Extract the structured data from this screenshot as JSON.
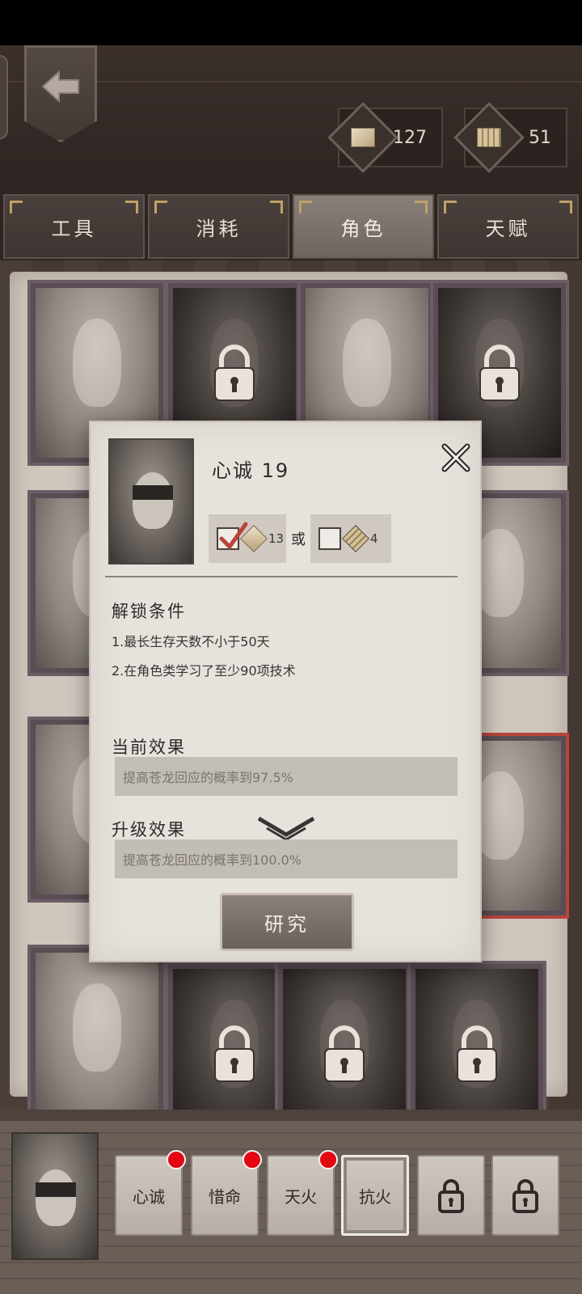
{
  "currencies": [
    {
      "icon": "diamond-currency-icon",
      "value": "127"
    },
    {
      "icon": "book-currency-icon",
      "value": "51"
    }
  ],
  "tabs": [
    {
      "label": "工具",
      "active": false
    },
    {
      "label": "消耗",
      "active": false
    },
    {
      "label": "角色",
      "active": true
    },
    {
      "label": "天赋",
      "active": false
    }
  ],
  "dialog": {
    "title": "心诚 19",
    "cost_option_1": {
      "checked": true,
      "icon": "diamond-currency-icon",
      "amount": "13"
    },
    "or_label": "或",
    "cost_option_2": {
      "checked": false,
      "icon": "book-currency-icon",
      "amount": "4"
    },
    "unlock_title": "解锁条件",
    "conditions": [
      "1.最长生存天数不小于50天",
      "2.在角色类学习了至少90项技术"
    ],
    "current_effect_title": "当前效果",
    "current_effect": "提高苍龙回应的概率到97.5%",
    "upgrade_effect_title": "升级效果",
    "upgrade_effect": "提高苍龙回应的概率到100.0%",
    "research_label": "研究"
  },
  "skills": [
    {
      "label": "心诚",
      "new": true,
      "locked": false
    },
    {
      "label": "惜命",
      "new": true,
      "locked": false
    },
    {
      "label": "天火",
      "new": true,
      "locked": false
    },
    {
      "label": "抗火",
      "new": false,
      "locked": false,
      "active": true
    },
    {
      "label": "",
      "new": false,
      "locked": true
    },
    {
      "label": "",
      "new": false,
      "locked": true
    }
  ],
  "colors": {
    "accent_gold": "#c0a067",
    "badge_red": "#e30611",
    "check_red": "#b8443a"
  }
}
